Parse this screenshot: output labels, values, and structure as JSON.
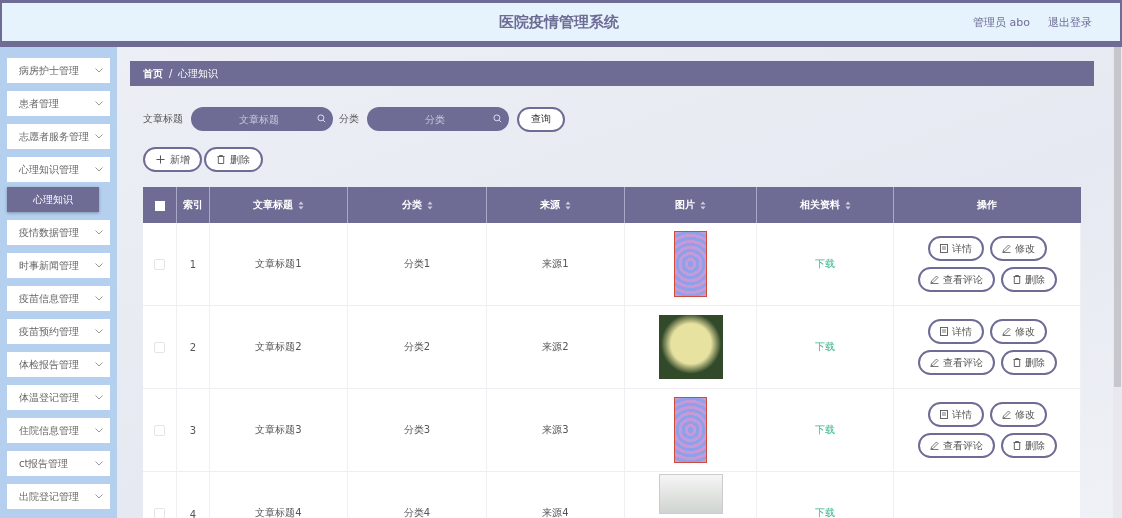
{
  "header": {
    "title": "医院疫情管理系统",
    "user": "管理员 abo",
    "logout": "退出登录"
  },
  "sidebar": {
    "items": [
      {
        "label": "病房护士管理"
      },
      {
        "label": "患者管理"
      },
      {
        "label": "志愿者服务管理"
      },
      {
        "label": "心理知识管理",
        "children": [
          {
            "label": "心理知识",
            "selected": true
          }
        ]
      },
      {
        "label": "疫情数据管理"
      },
      {
        "label": "时事新闻管理"
      },
      {
        "label": "疫苗信息管理"
      },
      {
        "label": "疫苗预约管理"
      },
      {
        "label": "体检报告管理"
      },
      {
        "label": "体温登记管理"
      },
      {
        "label": "住院信息管理"
      },
      {
        "label": "ct报告管理"
      },
      {
        "label": "出院登记管理"
      }
    ]
  },
  "breadcrumb": [
    "首页",
    "/",
    "心理知识"
  ],
  "search": {
    "fields": [
      {
        "label": "文章标题",
        "placeholder": "文章标题"
      },
      {
        "label": "分类",
        "placeholder": "分类"
      }
    ],
    "button": "查询"
  },
  "actions": [
    {
      "kind": "add",
      "label": "新增"
    },
    {
      "kind": "delete",
      "label": "删除"
    }
  ],
  "table": {
    "select_all_checked": false,
    "columns": [
      {
        "label": "索引",
        "sortable": false
      },
      {
        "label": "文章标题",
        "sortable": true
      },
      {
        "label": "分类",
        "sortable": true
      },
      {
        "label": "来源",
        "sortable": true
      },
      {
        "label": "图片",
        "sortable": true
      },
      {
        "label": "相关资料",
        "sortable": true
      },
      {
        "label": "操作",
        "sortable": false
      }
    ],
    "rows": [
      {
        "checked": false,
        "index": "1",
        "title": "文章标题1",
        "category": "分类1",
        "source": "来源1",
        "kind": "portrait",
        "link": "下载",
        "buttons": [
          {
            "kind": "detail",
            "label": "详情"
          },
          {
            "kind": "edit",
            "label": "修改"
          },
          {
            "kind": "comment",
            "label": "查看评论"
          },
          {
            "kind": "delete",
            "label": "删除"
          }
        ]
      },
      {
        "checked": false,
        "index": "2",
        "title": "文章标题2",
        "category": "分类2",
        "source": "来源2",
        "kind": "landscape",
        "link": "下载",
        "buttons": [
          {
            "kind": "detail",
            "label": "详情"
          },
          {
            "kind": "edit",
            "label": "修改"
          },
          {
            "kind": "comment",
            "label": "查看评论"
          },
          {
            "kind": "delete",
            "label": "删除"
          }
        ]
      },
      {
        "checked": false,
        "index": "3",
        "title": "文章标题3",
        "category": "分类3",
        "source": "来源3",
        "kind": "portrait",
        "link": "下载",
        "buttons": [
          {
            "kind": "detail",
            "label": "详情"
          },
          {
            "kind": "edit",
            "label": "修改"
          },
          {
            "kind": "comment",
            "label": "查看评论"
          },
          {
            "kind": "delete",
            "label": "删除"
          }
        ]
      },
      {
        "checked": false,
        "index": "4",
        "title": "文章标题4",
        "category": "分类4",
        "source": "来源4",
        "kind": "landscape",
        "link": "下载"
      }
    ]
  }
}
